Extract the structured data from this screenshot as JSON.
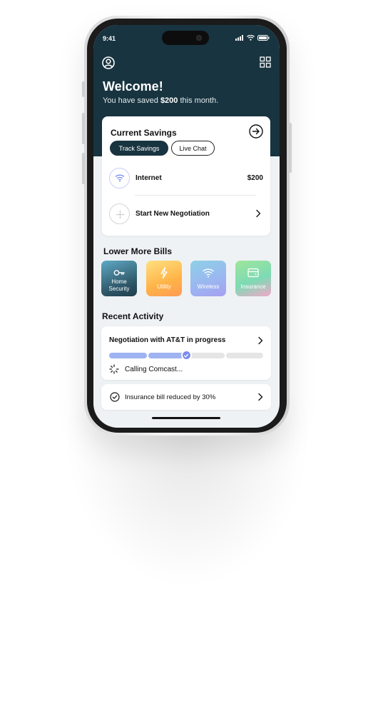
{
  "status_bar": {
    "time": "9:41"
  },
  "header": {
    "welcome": "Welcome!",
    "subtitle_prefix": "You have saved ",
    "subtitle_amount": "$200",
    "subtitle_suffix": " this month."
  },
  "savings_card": {
    "title": "Current Savings",
    "track_savings_label": "Track Savings",
    "live_chat_label": "Live Chat",
    "bill": {
      "name": "Internet",
      "amount": "$200"
    },
    "start_negotiation_label": "Start New Negotiation"
  },
  "lower_bills": {
    "title": "Lower More Bills",
    "tiles": [
      {
        "label_line1": "Home",
        "label_line2": "Security",
        "icon": "key-icon"
      },
      {
        "label_line1": "Utility",
        "label_line2": "",
        "icon": "lightning-icon"
      },
      {
        "label_line1": "Wireless",
        "label_line2": "",
        "icon": "wifi-icon"
      },
      {
        "label_line1": "Insurance",
        "label_line2": "",
        "icon": "wallet-icon"
      }
    ]
  },
  "recent_activity": {
    "title": "Recent Activity",
    "negotiation": {
      "title": "Negotiation with AT&T in progress",
      "progress_fraction": 0.5,
      "status": "Calling Comcast..."
    },
    "insurance": {
      "label": "Insurance bill reduced by 30%"
    }
  },
  "colors": {
    "header": "#183440",
    "accent": "#7b8cf0",
    "progress_fill": "#9fb3f2"
  }
}
